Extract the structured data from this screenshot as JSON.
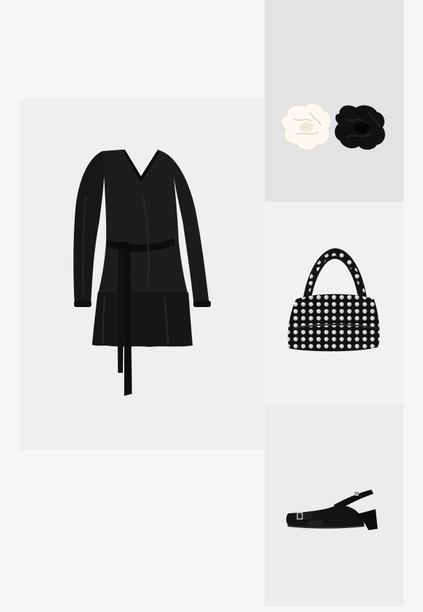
{
  "outfit": {
    "background": "#f6f6f6",
    "items": [
      {
        "id": "dress",
        "kind": "dress",
        "color": "black",
        "tile_bg": "#efefef"
      },
      {
        "id": "scrunchies",
        "kind": "hair scrunchies",
        "colors": [
          "white",
          "black"
        ],
        "tile_bg": "#e3e3e3"
      },
      {
        "id": "bag",
        "kind": "studded shoulder bag",
        "color": "black",
        "tile_bg": "#f1f1f1"
      },
      {
        "id": "shoe",
        "kind": "slingback heel",
        "color": "black",
        "tile_bg": "#ececec"
      }
    ]
  }
}
